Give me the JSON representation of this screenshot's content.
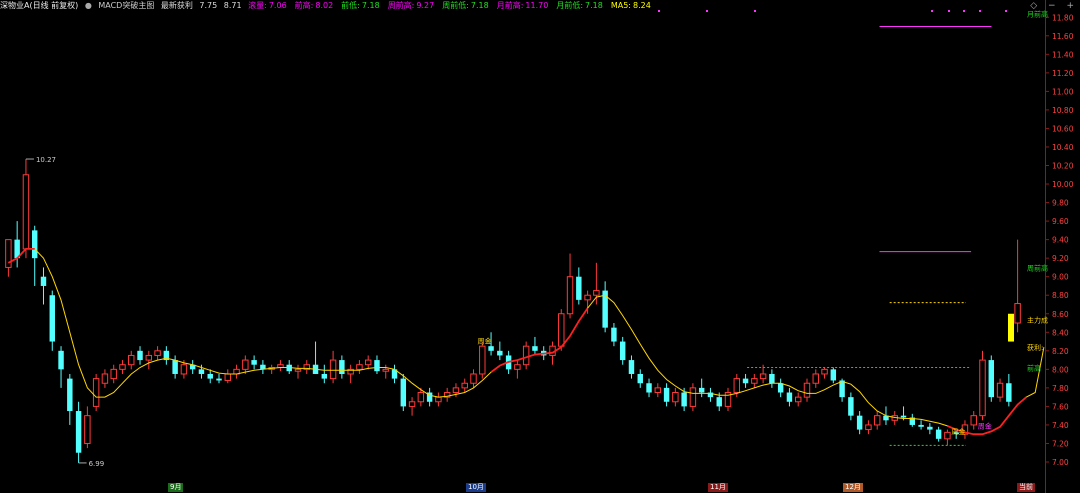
{
  "header": {
    "stock_label": "深物业A(日线 前复权)",
    "indicator_label": "MACD突破主图",
    "latest_profit_label": "最新获利",
    "latest_profit_value": "7.75",
    "profit_sep": "8.71",
    "field_items": [
      {
        "label": "滚量",
        "value": "7.06",
        "color": "#ff00ff"
      },
      {
        "label": "前高",
        "value": "8.02",
        "color": "#ff00ff"
      },
      {
        "label": "前低",
        "value": "7.18",
        "color": "#22dd22"
      },
      {
        "label": "周前高",
        "value": "9.27",
        "color": "#ff00ff"
      },
      {
        "label": "周前低",
        "value": "7.18",
        "color": "#22dd22"
      },
      {
        "label": "月前高",
        "value": "11.70",
        "color": "#ff00ff"
      },
      {
        "label": "月前低",
        "value": "7.18",
        "color": "#22dd22"
      },
      {
        "label": "MA5",
        "value": "8.24",
        "color": "#ffff00"
      }
    ]
  },
  "top_right_icons": [
    "diamond-icon",
    "minus-icon",
    "plus-icon"
  ],
  "top_right_glyphs": [
    "◇",
    "−",
    "+"
  ],
  "y_axis_ticks": [
    "11.80",
    "11.60",
    "11.40",
    "11.20",
    "11.00",
    "10.80",
    "10.60",
    "10.40",
    "10.20",
    "10.00",
    "9.80",
    "9.60",
    "9.40",
    "9.20",
    "9.00",
    "8.80",
    "8.60",
    "8.40",
    "8.20",
    "8.00",
    "7.80",
    "7.60",
    "7.40",
    "7.20",
    "7.00"
  ],
  "annotations": {
    "high_marker": "10.27",
    "low_marker": "6.99",
    "label_zhoujin_1": "周金",
    "label_zhoujin_2": "周金",
    "label_zhoujin_3": "周金",
    "label_zhouqianhigh": "周前高",
    "label_zhuli": "主力成",
    "label_huoli": "获利:",
    "label_qiangao": "前高",
    "label_yueqiangao": "月前高"
  },
  "bottom_tags": [
    {
      "label": "9月",
      "bg": "#1a6b1a"
    },
    {
      "label": "10月",
      "bg": "#1a3c8a"
    },
    {
      "label": "11月",
      "bg": "#8a1a1a"
    },
    {
      "label": "12月",
      "bg": "#b05a2a"
    },
    {
      "label": "当前",
      "bg": "#8a1a1a"
    }
  ],
  "colors": {
    "up": "#ff3a3a",
    "down": "#54ffff",
    "ma_yellow": "#ffd700",
    "ma_red": "#ff2020",
    "magenta": "#ff33ff",
    "green": "#22dd22",
    "grid_axis": "#8b1a1a"
  },
  "chart_data": {
    "type": "candlestick",
    "ylim": [
      7.0,
      11.9
    ],
    "candles": [
      [
        9.1,
        9.4,
        9.0,
        9.4
      ],
      [
        9.4,
        9.6,
        9.1,
        9.2
      ],
      [
        9.3,
        10.27,
        9.2,
        10.1
      ],
      [
        9.5,
        9.55,
        8.9,
        9.2
      ],
      [
        9.0,
        9.1,
        8.7,
        8.9
      ],
      [
        8.8,
        8.85,
        8.2,
        8.3
      ],
      [
        8.2,
        8.25,
        7.8,
        8.0
      ],
      [
        7.9,
        7.95,
        7.4,
        7.55
      ],
      [
        7.55,
        7.65,
        6.99,
        7.1
      ],
      [
        7.2,
        7.6,
        7.15,
        7.5
      ],
      [
        7.6,
        7.95,
        7.55,
        7.9
      ],
      [
        7.85,
        8.0,
        7.8,
        7.95
      ],
      [
        7.9,
        8.05,
        7.85,
        8.0
      ],
      [
        8.0,
        8.1,
        7.95,
        8.05
      ],
      [
        8.05,
        8.2,
        8.0,
        8.15
      ],
      [
        8.2,
        8.25,
        8.05,
        8.1
      ],
      [
        8.1,
        8.2,
        8.0,
        8.15
      ],
      [
        8.15,
        8.25,
        8.1,
        8.2
      ],
      [
        8.2,
        8.25,
        8.05,
        8.1
      ],
      [
        8.1,
        8.15,
        7.9,
        7.95
      ],
      [
        7.95,
        8.1,
        7.9,
        8.05
      ],
      [
        8.05,
        8.1,
        7.95,
        8.0
      ],
      [
        8.0,
        8.05,
        7.9,
        7.95
      ],
      [
        7.95,
        8.0,
        7.85,
        7.9
      ],
      [
        7.9,
        7.95,
        7.85,
        7.88
      ],
      [
        7.88,
        8.0,
        7.85,
        7.95
      ],
      [
        7.95,
        8.05,
        7.9,
        8.0
      ],
      [
        8.0,
        8.15,
        7.95,
        8.1
      ],
      [
        8.1,
        8.15,
        8.0,
        8.05
      ],
      [
        8.05,
        8.1,
        7.95,
        8.0
      ],
      [
        8.0,
        8.05,
        7.95,
        8.02
      ],
      [
        8.02,
        8.1,
        7.98,
        8.05
      ],
      [
        8.05,
        8.1,
        7.95,
        7.98
      ],
      [
        7.98,
        8.05,
        7.9,
        8.0
      ],
      [
        8.0,
        8.1,
        7.95,
        8.05
      ],
      [
        8.05,
        8.3,
        7.95,
        7.95
      ],
      [
        7.95,
        8.05,
        7.85,
        7.9
      ],
      [
        7.9,
        8.2,
        7.85,
        8.1
      ],
      [
        8.1,
        8.15,
        7.9,
        7.95
      ],
      [
        7.95,
        8.05,
        7.85,
        8.0
      ],
      [
        8.0,
        8.1,
        7.95,
        8.05
      ],
      [
        8.05,
        8.15,
        8.0,
        8.1
      ],
      [
        8.1,
        8.15,
        7.95,
        7.98
      ],
      [
        7.98,
        8.05,
        7.9,
        8.0
      ],
      [
        8.0,
        8.05,
        7.85,
        7.9
      ],
      [
        7.9,
        7.95,
        7.55,
        7.6
      ],
      [
        7.6,
        7.7,
        7.5,
        7.65
      ],
      [
        7.65,
        7.8,
        7.6,
        7.75
      ],
      [
        7.75,
        7.8,
        7.6,
        7.65
      ],
      [
        7.65,
        7.75,
        7.6,
        7.7
      ],
      [
        7.7,
        7.8,
        7.65,
        7.75
      ],
      [
        7.75,
        7.85,
        7.7,
        7.8
      ],
      [
        7.8,
        7.9,
        7.75,
        7.85
      ],
      [
        7.85,
        8.0,
        7.8,
        7.95
      ],
      [
        7.95,
        8.3,
        7.9,
        8.25
      ],
      [
        8.25,
        8.4,
        8.15,
        8.2
      ],
      [
        8.2,
        8.3,
        8.1,
        8.15
      ],
      [
        8.15,
        8.2,
        7.95,
        8.0
      ],
      [
        8.0,
        8.1,
        7.9,
        8.05
      ],
      [
        8.05,
        8.3,
        8.0,
        8.25
      ],
      [
        8.25,
        8.35,
        8.15,
        8.2
      ],
      [
        8.2,
        8.25,
        8.1,
        8.15
      ],
      [
        8.15,
        8.3,
        8.05,
        8.25
      ],
      [
        8.25,
        8.65,
        8.2,
        8.6
      ],
      [
        8.6,
        9.25,
        8.55,
        9.0
      ],
      [
        9.0,
        9.1,
        8.7,
        8.75
      ],
      [
        8.75,
        8.85,
        8.6,
        8.8
      ],
      [
        8.8,
        9.15,
        8.7,
        8.85
      ],
      [
        8.85,
        8.95,
        8.4,
        8.45
      ],
      [
        8.45,
        8.5,
        8.25,
        8.3
      ],
      [
        8.3,
        8.35,
        8.05,
        8.1
      ],
      [
        8.1,
        8.15,
        7.9,
        7.95
      ],
      [
        7.95,
        8.0,
        7.8,
        7.85
      ],
      [
        7.85,
        7.9,
        7.7,
        7.75
      ],
      [
        7.75,
        7.85,
        7.7,
        7.8
      ],
      [
        7.8,
        7.85,
        7.6,
        7.65
      ],
      [
        7.65,
        7.8,
        7.6,
        7.75
      ],
      [
        7.75,
        7.8,
        7.55,
        7.6
      ],
      [
        7.6,
        7.85,
        7.55,
        7.8
      ],
      [
        7.8,
        7.9,
        7.7,
        7.75
      ],
      [
        7.75,
        7.8,
        7.65,
        7.7
      ],
      [
        7.7,
        7.75,
        7.55,
        7.6
      ],
      [
        7.6,
        7.8,
        7.55,
        7.75
      ],
      [
        7.75,
        7.95,
        7.7,
        7.9
      ],
      [
        7.9,
        7.95,
        7.8,
        7.85
      ],
      [
        7.85,
        7.95,
        7.8,
        7.9
      ],
      [
        7.9,
        8.05,
        7.85,
        7.95
      ],
      [
        7.95,
        8.0,
        7.8,
        7.85
      ],
      [
        7.85,
        7.9,
        7.7,
        7.75
      ],
      [
        7.75,
        7.8,
        7.6,
        7.65
      ],
      [
        7.65,
        7.75,
        7.6,
        7.7
      ],
      [
        7.7,
        7.9,
        7.65,
        7.85
      ],
      [
        7.85,
        8.0,
        7.8,
        7.95
      ],
      [
        7.95,
        8.02,
        7.9,
        8.0
      ],
      [
        8.0,
        8.02,
        7.85,
        7.88
      ],
      [
        7.88,
        7.9,
        7.65,
        7.7
      ],
      [
        7.7,
        7.75,
        7.45,
        7.5
      ],
      [
        7.5,
        7.55,
        7.3,
        7.35
      ],
      [
        7.35,
        7.45,
        7.3,
        7.4
      ],
      [
        7.4,
        7.55,
        7.35,
        7.5
      ],
      [
        7.5,
        7.6,
        7.4,
        7.45
      ],
      [
        7.45,
        7.55,
        7.4,
        7.5
      ],
      [
        7.5,
        7.6,
        7.45,
        7.48
      ],
      [
        7.48,
        7.52,
        7.38,
        7.4
      ],
      [
        7.4,
        7.45,
        7.35,
        7.38
      ],
      [
        7.38,
        7.42,
        7.3,
        7.35
      ],
      [
        7.35,
        7.38,
        7.22,
        7.25
      ],
      [
        7.25,
        7.35,
        7.18,
        7.32
      ],
      [
        7.32,
        7.35,
        7.25,
        7.3
      ],
      [
        7.3,
        7.45,
        7.25,
        7.4
      ],
      [
        7.4,
        7.55,
        7.35,
        7.5
      ],
      [
        7.5,
        8.2,
        7.45,
        8.1
      ],
      [
        8.1,
        8.15,
        7.65,
        7.7
      ],
      [
        7.7,
        7.9,
        7.65,
        7.85
      ],
      [
        7.85,
        7.95,
        7.6,
        7.65
      ],
      [
        8.5,
        9.4,
        8.4,
        8.71
      ]
    ],
    "ma_points": [
      9.15,
      9.2,
      9.3,
      9.3,
      9.2,
      9.0,
      8.75,
      8.4,
      8.05,
      7.8,
      7.7,
      7.7,
      7.75,
      7.85,
      7.95,
      8.02,
      8.07,
      8.1,
      8.12,
      8.1,
      8.07,
      8.05,
      8.02,
      7.99,
      7.96,
      7.95,
      7.95,
      7.97,
      7.99,
      8.0,
      8.01,
      8.02,
      8.02,
      8.01,
      8.01,
      8.0,
      7.99,
      7.99,
      7.99,
      7.99,
      7.99,
      8.01,
      8.02,
      8.02,
      8.0,
      7.93,
      7.85,
      7.78,
      7.72,
      7.7,
      7.71,
      7.73,
      7.75,
      7.8,
      7.88,
      7.97,
      8.04,
      8.08,
      8.1,
      8.13,
      8.16,
      8.17,
      8.18,
      8.24,
      8.36,
      8.52,
      8.66,
      8.78,
      8.8,
      8.72,
      8.58,
      8.43,
      8.27,
      8.12,
      7.99,
      7.89,
      7.82,
      7.76,
      7.74,
      7.74,
      7.74,
      7.72,
      7.72,
      7.74,
      7.77,
      7.8,
      7.83,
      7.85,
      7.85,
      7.82,
      7.77,
      7.74,
      7.74,
      7.78,
      7.83,
      7.87,
      7.84,
      7.76,
      7.64,
      7.55,
      7.5,
      7.48,
      7.47,
      7.47,
      7.46,
      7.44,
      7.42,
      7.39,
      7.35,
      7.32,
      7.3,
      7.3,
      7.33,
      7.38,
      7.5,
      7.62,
      7.7,
      7.75,
      8.24
    ],
    "red_segments": [
      [
        0,
        3
      ],
      [
        55,
        66
      ],
      [
        107,
        116
      ]
    ],
    "hlines": [
      {
        "price": 11.7,
        "from": 0.86,
        "to": 0.97,
        "color": "#ff33ff",
        "style": "solid"
      },
      {
        "price": 9.27,
        "from": 0.86,
        "to": 0.95,
        "color": "#ff33ff",
        "style": "solid"
      },
      {
        "price": 8.72,
        "from": 0.87,
        "to": 0.945,
        "color": "#ffd700",
        "style": "dotted"
      },
      {
        "price": 8.02,
        "from": 0.73,
        "to": 0.95,
        "color": "#ff33ff",
        "style": "dotted"
      },
      {
        "price": 7.18,
        "from": 0.87,
        "to": 0.945,
        "color": "#22dd22",
        "style": "dotted"
      }
    ]
  }
}
